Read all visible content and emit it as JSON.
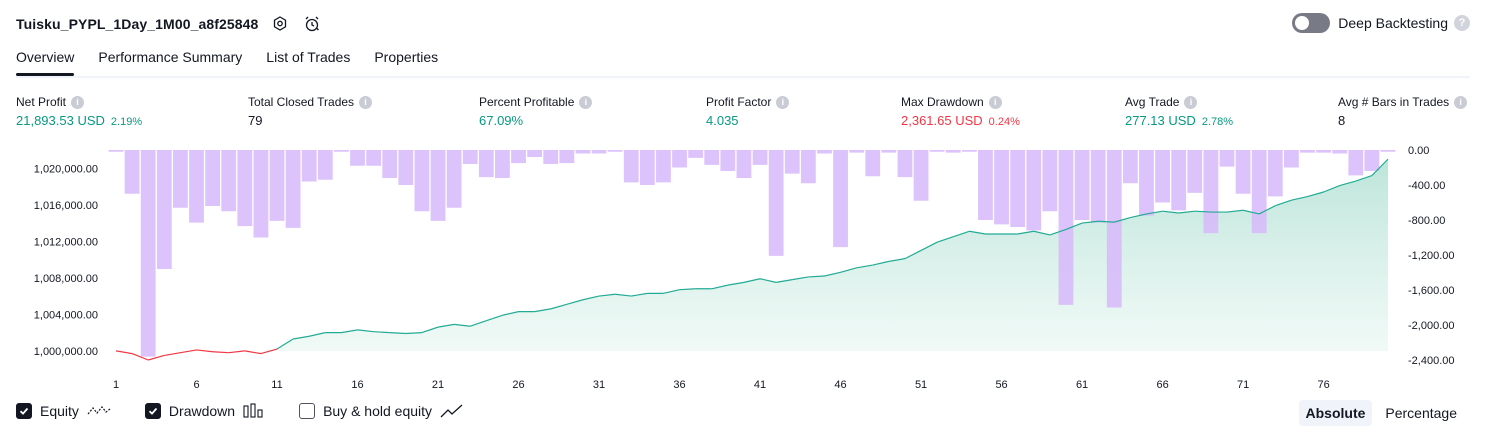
{
  "header": {
    "strategy_name": "Tuisku_PYPL_1Day_1M00_a8f25848",
    "settings_icon": "gear-icon",
    "alert_icon": "alarm-clock-icon"
  },
  "deep_backtesting": {
    "label": "Deep Backtesting",
    "enabled": false,
    "help": "?"
  },
  "tabs": [
    {
      "label": "Overview",
      "active": true
    },
    {
      "label": "Performance Summary",
      "active": false
    },
    {
      "label": "List of Trades",
      "active": false
    },
    {
      "label": "Properties",
      "active": false
    }
  ],
  "metrics": {
    "net_profit": {
      "label": "Net Profit",
      "value": "21,893.53 USD",
      "pct": "2.19%"
    },
    "total_closed_trades": {
      "label": "Total Closed Trades",
      "value": "79"
    },
    "percent_profitable": {
      "label": "Percent Profitable",
      "value": "67.09%"
    },
    "profit_factor": {
      "label": "Profit Factor",
      "value": "4.035"
    },
    "max_drawdown": {
      "label": "Max Drawdown",
      "value": "2,361.65 USD",
      "pct": "0.24%"
    },
    "avg_trade": {
      "label": "Avg Trade",
      "value": "277.13 USD",
      "pct": "2.78%"
    },
    "avg_bars": {
      "label": "Avg # Bars in Trades",
      "value": "8"
    }
  },
  "info_glyph": "i",
  "colors": {
    "green": "#089981",
    "red": "#f23645",
    "drawdown_bar": "#d7b9fa",
    "equity_fill": "#cdebe3"
  },
  "chart_data": {
    "type": "line",
    "x_ticks": [
      1,
      6,
      11,
      16,
      21,
      26,
      31,
      36,
      41,
      46,
      51,
      56,
      61,
      66,
      71,
      76
    ],
    "equity_axis": {
      "ticks": [
        1000000,
        1004000,
        1008000,
        1012000,
        1016000,
        1020000
      ],
      "tick_labels": [
        "1,000,000.00",
        "1,004,000.00",
        "1,008,000.00",
        "1,012,000.00",
        "1,016,000.00",
        "1,020,000.00"
      ],
      "range": [
        999000,
        1022000
      ]
    },
    "drawdown_axis": {
      "ticks": [
        0,
        -400,
        -800,
        -1200,
        -1600,
        -2000,
        -2400
      ],
      "tick_labels": [
        "0.00",
        "-400.00",
        "-800.00",
        "-1,200.00",
        "-1,600.00",
        "-2,000.00",
        "-2,400.00"
      ],
      "range": [
        -2400,
        0
      ]
    },
    "series": [
      {
        "name": "Equity",
        "x": [
          1,
          2,
          3,
          4,
          5,
          6,
          7,
          8,
          9,
          10,
          11,
          12,
          13,
          14,
          15,
          16,
          17,
          18,
          19,
          20,
          21,
          22,
          23,
          24,
          25,
          26,
          27,
          28,
          29,
          30,
          31,
          32,
          33,
          34,
          35,
          36,
          37,
          38,
          39,
          40,
          41,
          42,
          43,
          44,
          45,
          46,
          47,
          48,
          49,
          50,
          51,
          52,
          53,
          54,
          55,
          56,
          57,
          58,
          59,
          60,
          61,
          62,
          63,
          64,
          65,
          66,
          67,
          68,
          69,
          70,
          71,
          72,
          73,
          74,
          75,
          76,
          77,
          78,
          79,
          80
        ],
        "values": [
          1000000,
          999700,
          999000,
          999500,
          999800,
          1000100,
          999900,
          999800,
          1000000,
          999700,
          1000200,
          1001300,
          1001600,
          1002000,
          1002000,
          1002300,
          1002100,
          1002000,
          1001900,
          1002000,
          1002600,
          1002900,
          1002700,
          1003300,
          1003900,
          1004300,
          1004300,
          1004600,
          1005100,
          1005600,
          1006000,
          1006200,
          1006000,
          1006300,
          1006300,
          1006700,
          1006800,
          1006800,
          1007200,
          1007500,
          1007900,
          1007500,
          1007800,
          1008100,
          1008200,
          1008600,
          1009100,
          1009400,
          1009800,
          1010100,
          1011000,
          1011900,
          1012500,
          1013100,
          1012800,
          1012800,
          1012800,
          1013100,
          1012700,
          1013300,
          1014000,
          1014200,
          1014100,
          1014600,
          1015000,
          1015300,
          1015100,
          1015300,
          1015200,
          1015200,
          1015400,
          1015000,
          1015900,
          1016500,
          1016900,
          1017400,
          1018100,
          1018600,
          1019200,
          1021000
        ]
      },
      {
        "name": "Drawdown",
        "x": [
          1,
          2,
          3,
          4,
          5,
          6,
          7,
          8,
          9,
          10,
          11,
          12,
          13,
          14,
          15,
          16,
          17,
          18,
          19,
          20,
          21,
          22,
          23,
          24,
          25,
          26,
          27,
          28,
          29,
          30,
          31,
          32,
          33,
          34,
          35,
          36,
          37,
          38,
          39,
          40,
          41,
          42,
          43,
          44,
          45,
          46,
          47,
          48,
          49,
          50,
          51,
          52,
          53,
          54,
          55,
          56,
          57,
          58,
          59,
          60,
          61,
          62,
          63,
          64,
          65,
          66,
          67,
          68,
          69,
          70,
          71,
          72,
          73,
          74,
          75,
          76,
          77,
          78,
          79,
          80
        ],
        "values": [
          -20,
          -500,
          -2361.65,
          -1360,
          -660,
          -830,
          -640,
          -700,
          -870,
          -1000,
          -810,
          -890,
          -360,
          -340,
          -20,
          -180,
          -180,
          -320,
          -400,
          -700,
          -810,
          -660,
          -160,
          -310,
          -320,
          -150,
          -80,
          -160,
          -150,
          -40,
          -40,
          -20,
          -370,
          -400,
          -370,
          -200,
          -90,
          -170,
          -240,
          -320,
          -170,
          -1210,
          -270,
          -380,
          -40,
          -1110,
          -30,
          -300,
          -30,
          -310,
          -580,
          -20,
          -30,
          -20,
          -800,
          -850,
          -880,
          -920,
          -700,
          -1770,
          -800,
          -830,
          -1800,
          -380,
          -750,
          -600,
          -690,
          -490,
          -950,
          -190,
          -500,
          -950,
          -530,
          -200,
          -30,
          -30,
          -40,
          -290,
          -240,
          -20
        ]
      },
      {
        "name": "Buy & hold equity",
        "x": [],
        "values": []
      }
    ],
    "grid": false,
    "legend_position": "bottom-left"
  },
  "legend": [
    {
      "label": "Equity",
      "checked": true,
      "icon": "equity-line-icon"
    },
    {
      "label": "Drawdown",
      "checked": true,
      "icon": "drawdown-bars-icon"
    },
    {
      "label": "Buy & hold equity",
      "checked": false,
      "icon": "buy-hold-line-icon"
    }
  ],
  "modes": [
    {
      "label": "Absolute",
      "active": true
    },
    {
      "label": "Percentage",
      "active": false
    }
  ]
}
